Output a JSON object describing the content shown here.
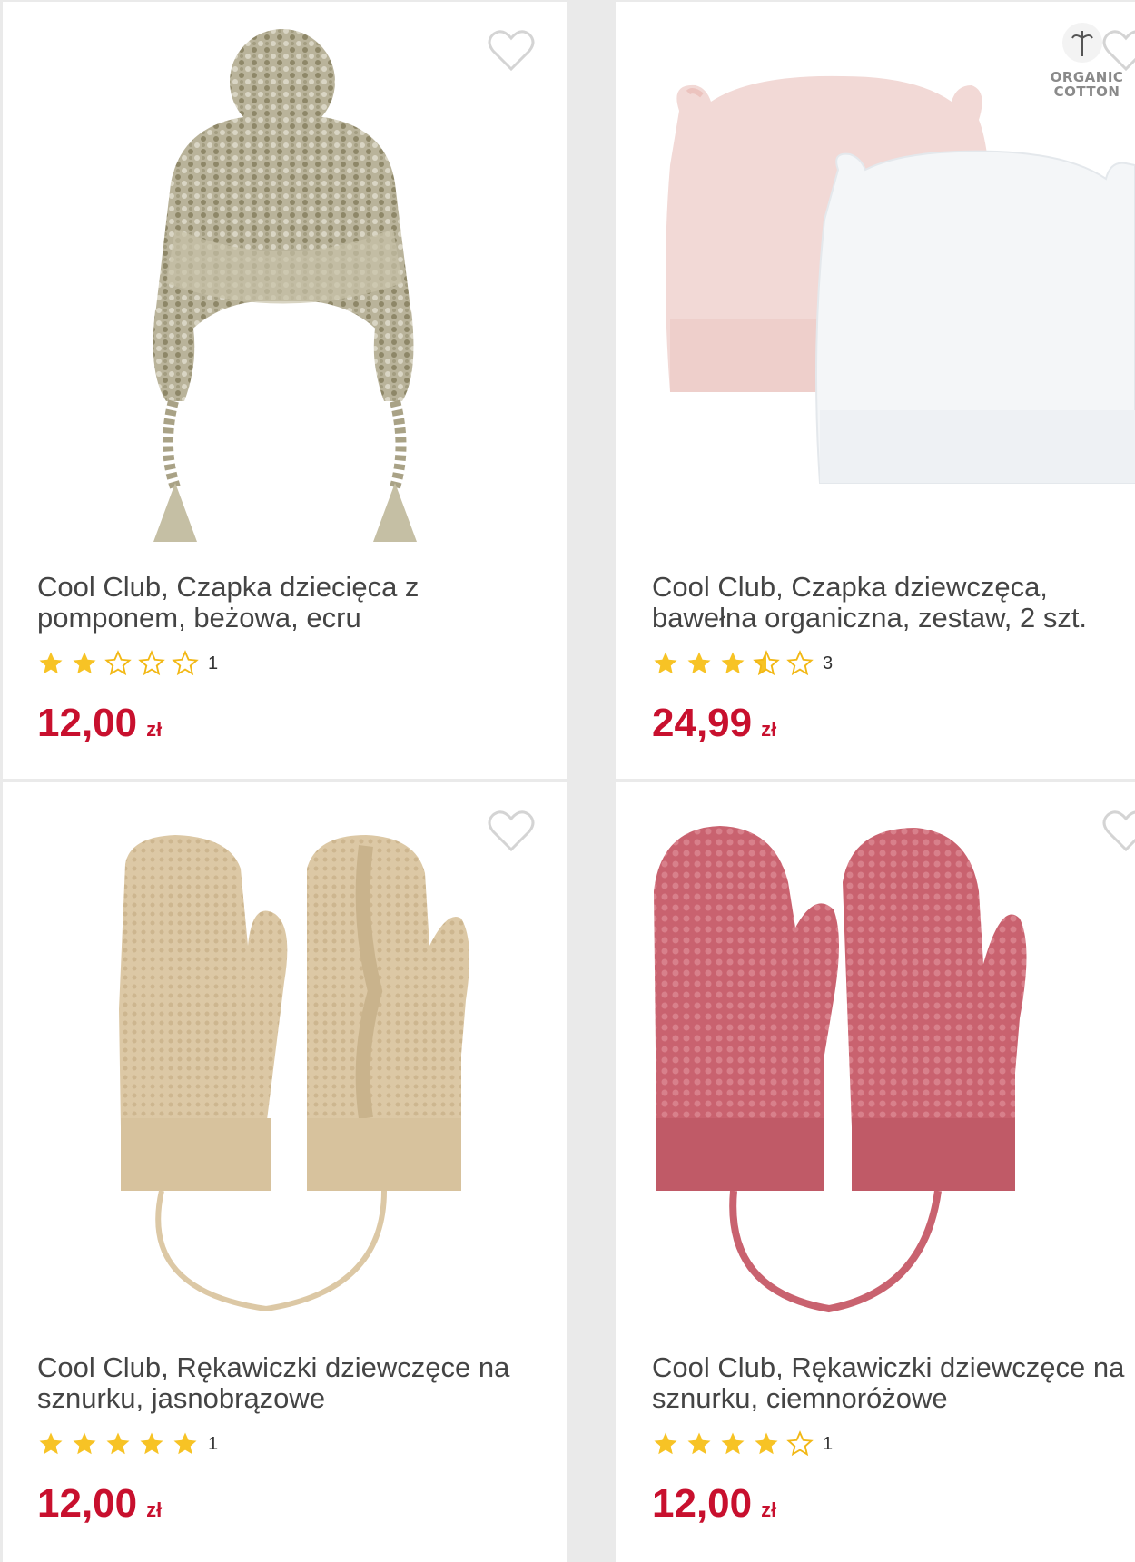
{
  "colors": {
    "price": "#c8102e",
    "star_filled": "#f7c325",
    "star_outline": "#f2b815",
    "title": "#444444",
    "background": "#eaeaea",
    "card": "#ffffff"
  },
  "products": [
    {
      "title": "Cool Club, Czapka dziecięca z pomponem, beżowa, ecru",
      "rating_value": 2,
      "rating_max": 5,
      "rating_count": "1",
      "price": "12,00",
      "currency": "zł",
      "image": "beige-knit-hat-with-pompom",
      "favorite_icon": "heart-outline-icon"
    },
    {
      "title": "Cool Club, Czapka dziewczęca, bawełna organiczna, zestaw, 2 szt.",
      "badge": "ORGANIC COTTON",
      "rating_value": 3.5,
      "rating_max": 5,
      "rating_count": "3",
      "price": "24,99",
      "currency": "zł",
      "image": "pink-and-white-bear-ear-hats",
      "favorite_icon": "heart-outline-icon"
    },
    {
      "title": "Cool Club, Rękawiczki dziewczęce na sznurku, jasnobrązowe",
      "rating_value": 5,
      "rating_max": 5,
      "rating_count": "1",
      "price": "12,00",
      "currency": "zł",
      "image": "beige-mittens-on-string",
      "favorite_icon": "heart-outline-icon"
    },
    {
      "title": "Cool Club, Rękawiczki dziewczęce na sznurku, ciemnoróżowe",
      "rating_value": 4,
      "rating_max": 5,
      "rating_count": "1",
      "price": "12,00",
      "currency": "zł",
      "image": "dark-pink-mittens-on-string",
      "favorite_icon": "heart-outline-icon"
    }
  ]
}
